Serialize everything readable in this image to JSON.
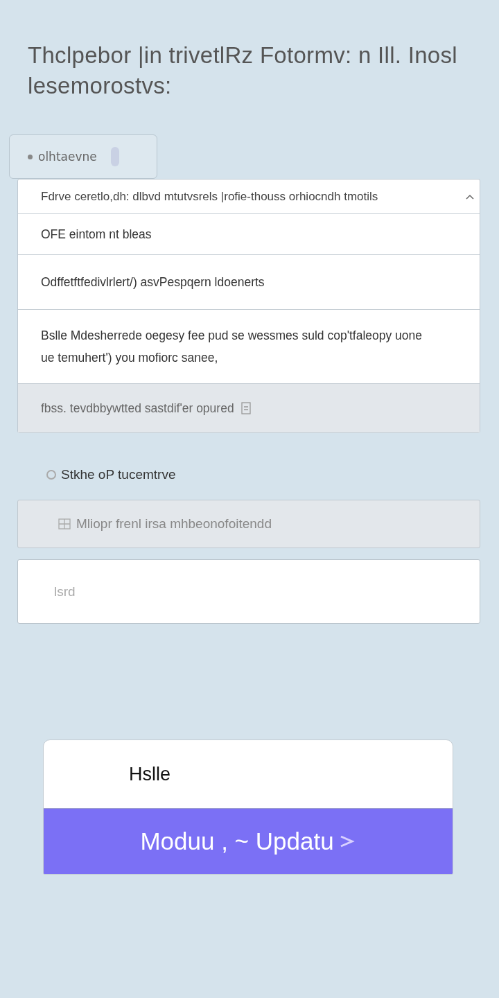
{
  "heading": "Thclpebor |in trivetlRz Fotormv: n Ill. Inosl lesemorostvs:",
  "chip": {
    "label": "olhtaevne"
  },
  "list": {
    "rows": [
      {
        "text": "Fdrve ceretlo,dh: dlbvd mtutvsrels |rofie-thouss orhiocndh tmotils",
        "kind": "header"
      },
      {
        "text": "OFE eintom nt bleas",
        "kind": "plain"
      },
      {
        "text": "Odffetftfedivlrlert/) asvPespqern ldoenerts",
        "kind": "plain"
      },
      {
        "text": "Bslle Mdesherrede oegesy fee pud         se wessmes suld cop'tfaleopy uone ue temuhert') you mofiorc sanee,",
        "kind": "plain"
      },
      {
        "text": "fbss. tevdbbywtted sastdif'er opured",
        "kind": "footer"
      }
    ]
  },
  "section_label": "Stkhe oP tucemtrve",
  "info_field": {
    "value": "Mliopr frenl irsa mhbeonofoitendd"
  },
  "input_field": {
    "placeholder": "lsrd"
  },
  "card": {
    "title": "Hslle",
    "button": "Moduu , ~ Updatu"
  }
}
